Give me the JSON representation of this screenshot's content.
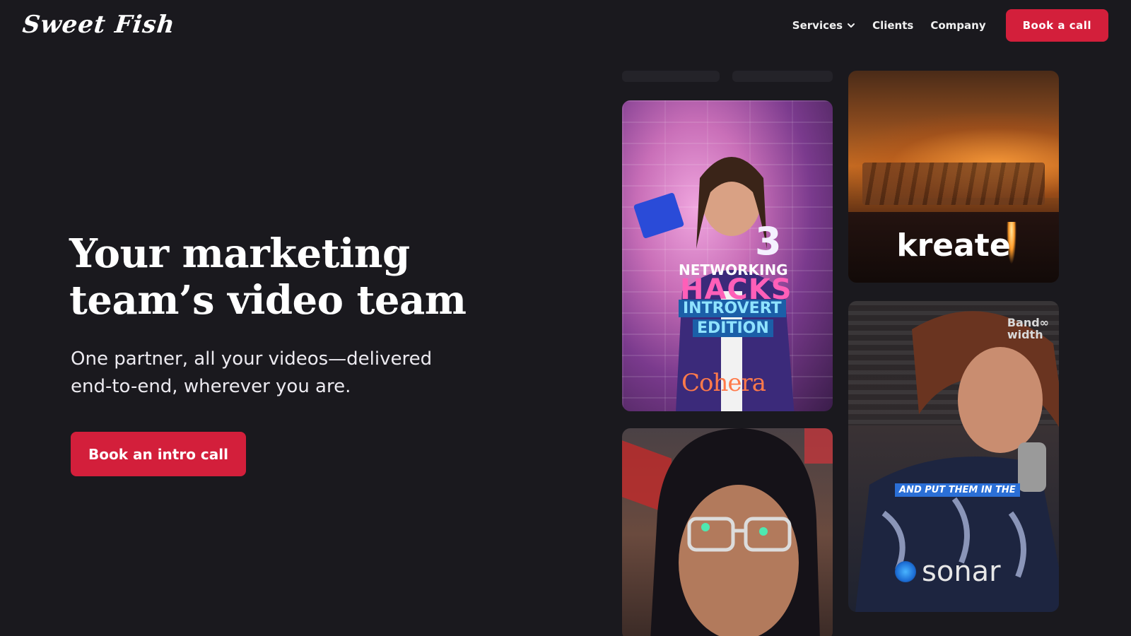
{
  "nav": {
    "logo": "Sweet Fish",
    "links": [
      "Services",
      "Clients",
      "Company"
    ],
    "cta": "Book a call"
  },
  "hero": {
    "title_line1": "Your marketing",
    "title_line2": "team’s video team",
    "sub_line1": "One partner, all your videos—delivered",
    "sub_line2": "end-to-end, wherever you are.",
    "cta": "Book an intro call"
  },
  "videos": {
    "cohera": {
      "number": "3",
      "line1": "NETWORKING",
      "line2": "HACKS",
      "line3": "INTROVERT",
      "line4": "EDITION",
      "brand": "Cohera"
    },
    "kreate": {
      "brand": "kreate"
    },
    "sonar": {
      "badge_line1": "Band∞",
      "badge_line2": "width",
      "caption": "AND PUT THEM IN THE",
      "brand": "sonar"
    }
  },
  "colors": {
    "background": "#1a191e",
    "accent": "#d31f3b",
    "text": "#ffffff"
  },
  "icons": {
    "services_dropdown": "chevron-down-icon"
  }
}
